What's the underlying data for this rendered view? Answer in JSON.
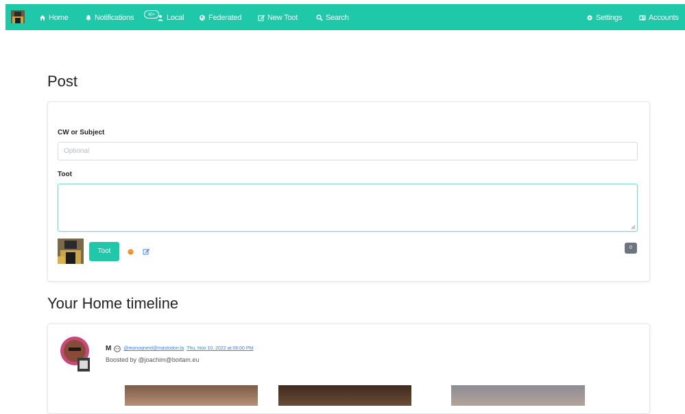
{
  "nav": {
    "items": [
      {
        "label": "Home",
        "icon": "home-icon"
      },
      {
        "label": "Notifications",
        "icon": "bell-icon"
      },
      {
        "label": "Local",
        "icon": "users-icon"
      },
      {
        "label": "Federated",
        "icon": "globe-icon"
      },
      {
        "label": "New Toot",
        "icon": "edit-icon"
      },
      {
        "label": "Search",
        "icon": "search-icon"
      }
    ],
    "notifications_badge": "40+",
    "right_items": [
      {
        "label": "Settings",
        "icon": "gear-icon"
      },
      {
        "label": "Accounts",
        "icon": "id-card-icon"
      }
    ]
  },
  "post": {
    "heading": "Post",
    "cw_label": "CW or Subject",
    "cw_placeholder": "Optional",
    "toot_label": "Toot",
    "toot_button": "Toot",
    "char_count": "0"
  },
  "timeline": {
    "heading": "Your Home timeline",
    "status": {
      "display_name": "M",
      "handle": "@monoqnerd@mastodon.la",
      "timestamp": "Thu, Nov 10, 2022 at 06:00 PM",
      "boosted_by": "Boosted by @joachim@boitam.eu"
    }
  },
  "colors": {
    "accent": "#1fc8a8",
    "link": "#3b82f6"
  }
}
